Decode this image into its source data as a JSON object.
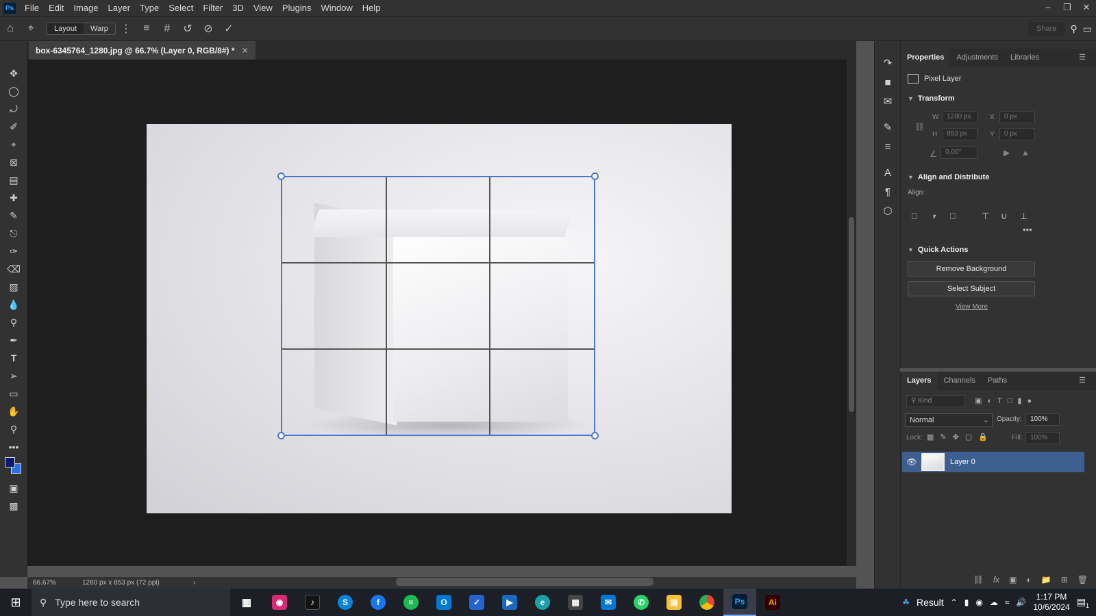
{
  "app": {
    "logo": "Ps"
  },
  "menu": [
    "File",
    "Edit",
    "Image",
    "Layer",
    "Type",
    "Select",
    "Filter",
    "3D",
    "View",
    "Plugins",
    "Window",
    "Help"
  ],
  "options_bar": {
    "layout_label": "Layout",
    "warp_label": "Warp",
    "share_label": "Share"
  },
  "document": {
    "tab_title": "box-6345764_1280.jpg @ 66.7% (Layer 0, RGB/8#) *",
    "zoom": "66.67%",
    "info": "1280 px x 853 px (72 ppi)"
  },
  "properties": {
    "tabs": [
      "Properties",
      "Adjustments",
      "Libraries"
    ],
    "layer_kind": "Pixel Layer",
    "transform_title": "Transform",
    "w_label": "W",
    "w_value": "1280 px",
    "h_label": "H",
    "h_value": "853 px",
    "x_label": "X",
    "x_value": "0 px",
    "y_label": "Y",
    "y_value": "0 px",
    "angle_value": "0.00°",
    "align_title": "Align and Distribute",
    "align_label": "Align:",
    "quick_actions_title": "Quick Actions",
    "remove_bg": "Remove Background",
    "select_subject": "Select Subject",
    "view_more": "View More"
  },
  "layers_panel": {
    "tabs": [
      "Layers",
      "Channels",
      "Paths"
    ],
    "filter_placeholder": "Kind",
    "blend_mode": "Normal",
    "opacity_label": "Opacity:",
    "opacity_value": "100%",
    "lock_label": "Lock:",
    "fill_label": "Fill:",
    "fill_value": "100%",
    "layer_name": "Layer 0"
  },
  "taskbar": {
    "search_placeholder": "Type here to search",
    "weather": "Result",
    "time": "1:17 PM",
    "date": "10/6/2024",
    "notification_count": "1"
  },
  "colors": {
    "accent": "#4a78c8",
    "foreground": "#0a1a6e",
    "background": "#2a6ee8"
  }
}
